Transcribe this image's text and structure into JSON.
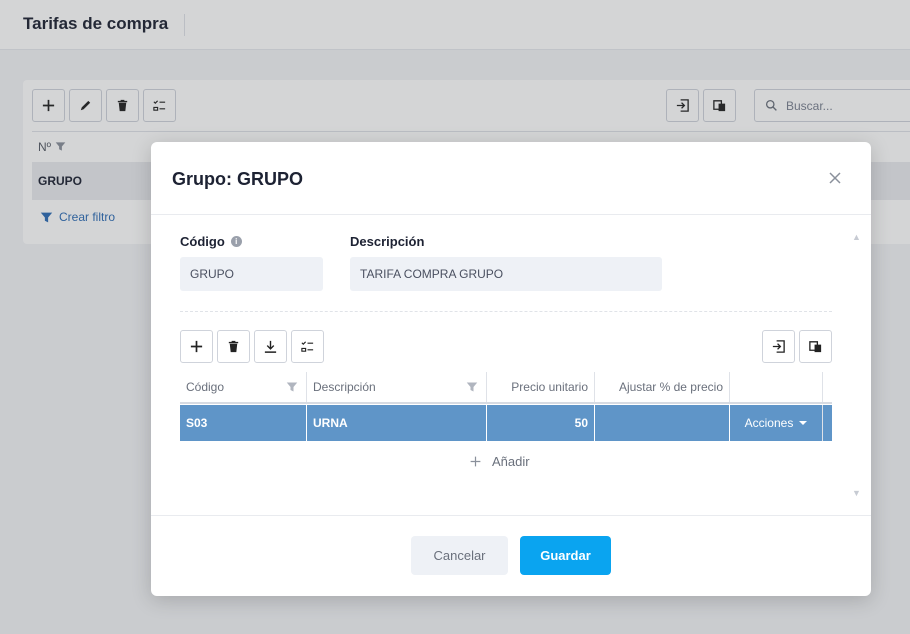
{
  "page": {
    "title": "Tarifas de compra"
  },
  "background_list": {
    "search_placeholder": "Buscar...",
    "columns": [
      "Nº"
    ],
    "row_value": "GRUPO",
    "filter_link": "Crear filtro"
  },
  "modal": {
    "title": "Grupo: GRUPO",
    "codigo_label": "Código",
    "codigo_value": "GRUPO",
    "descripcion_label": "Descripción",
    "descripcion_value": "TARIFA COMPRA GRUPO",
    "grid": {
      "headers": [
        "Código",
        "Descripción",
        "Precio unitario",
        "Ajustar % de precio",
        ""
      ],
      "rows": [
        {
          "codigo": "S03",
          "descripcion": "URNA",
          "precio": "50",
          "ajustar": "",
          "acciones": "Acciones"
        }
      ]
    },
    "add_label": "Añadir",
    "cancel_label": "Cancelar",
    "save_label": "Guardar"
  },
  "colors": {
    "accent": "#0aa4f0",
    "selected_row": "#5f95c8"
  }
}
